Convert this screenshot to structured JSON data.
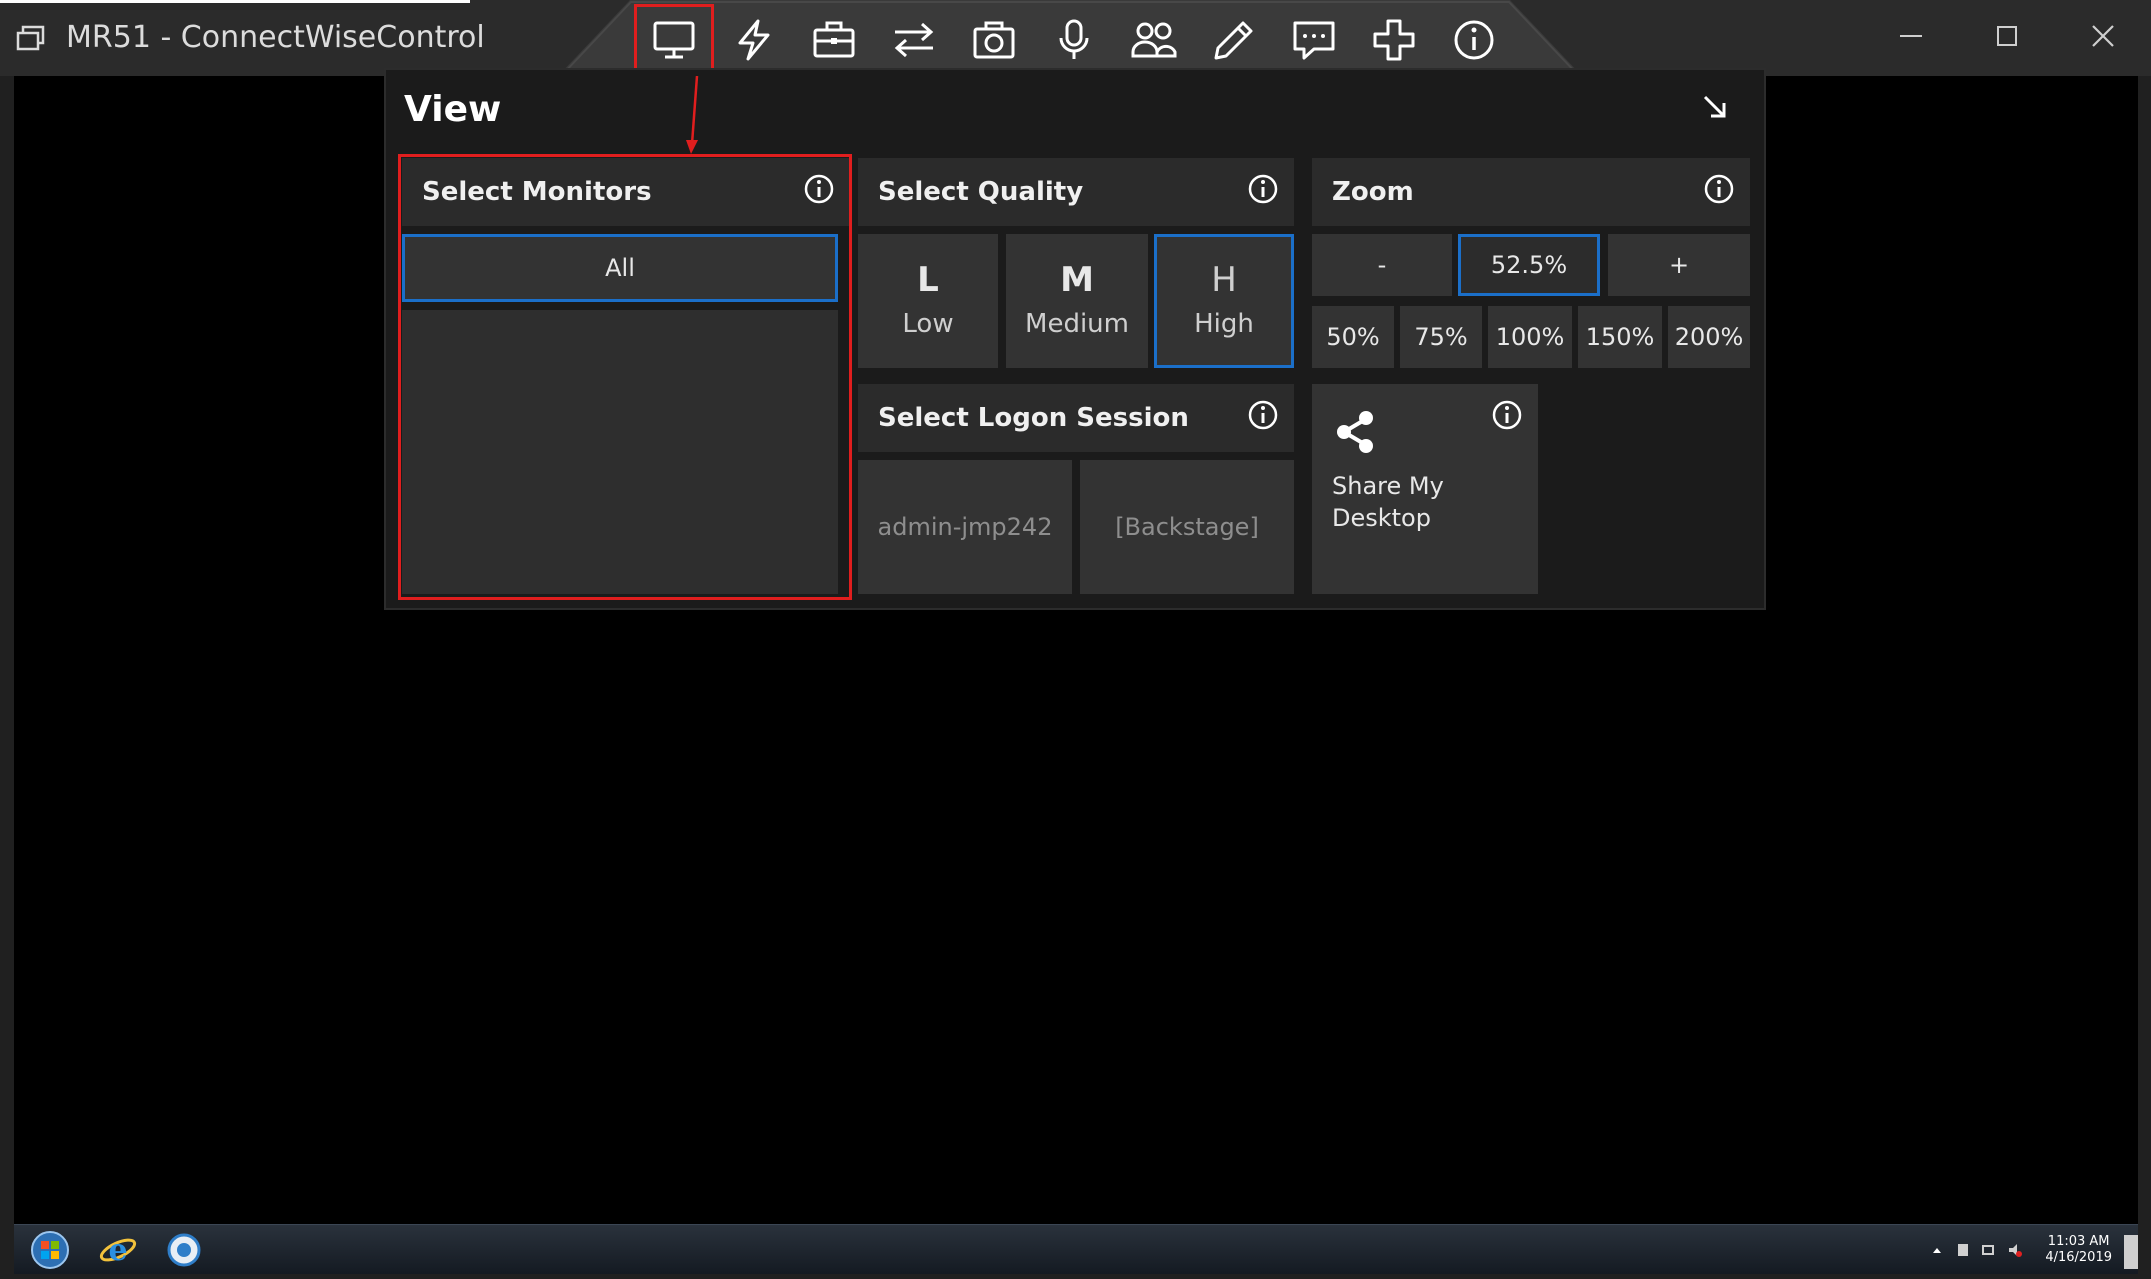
{
  "window": {
    "title": "MR51 - ConnectWiseControl"
  },
  "toolbar": {
    "items": [
      {
        "name": "view",
        "icon": "monitor-icon",
        "selected": true
      },
      {
        "name": "actions",
        "icon": "lightning-icon"
      },
      {
        "name": "toolbox",
        "icon": "briefcase-icon"
      },
      {
        "name": "transfer",
        "icon": "transfer-arrows-icon"
      },
      {
        "name": "screenshot",
        "icon": "camera-icon"
      },
      {
        "name": "audio",
        "icon": "microphone-icon"
      },
      {
        "name": "participants",
        "icon": "people-icon"
      },
      {
        "name": "annotate",
        "icon": "pencil-icon"
      },
      {
        "name": "messages",
        "icon": "chat-icon"
      },
      {
        "name": "extensions",
        "icon": "puzzle-icon"
      },
      {
        "name": "info",
        "icon": "info-circle-icon"
      }
    ]
  },
  "view_panel": {
    "title": "View",
    "monitors": {
      "header": "Select Monitors",
      "options": [
        {
          "label": "All",
          "selected": true
        }
      ]
    },
    "quality": {
      "header": "Select Quality",
      "options": [
        {
          "letter": "L",
          "label": "Low",
          "selected": false
        },
        {
          "letter": "M",
          "label": "Medium",
          "selected": false
        },
        {
          "letter": "H",
          "label": "High",
          "selected": true
        }
      ]
    },
    "zoom": {
      "header": "Zoom",
      "decrease": "-",
      "current": "52.5%",
      "increase": "+",
      "presets": [
        "50%",
        "75%",
        "100%",
        "150%",
        "200%"
      ]
    },
    "logon_session": {
      "header": "Select Logon Session",
      "options": [
        "admin-jmp242",
        "[Backstage]"
      ]
    },
    "share": {
      "line1": "Share My",
      "line2": "Desktop"
    }
  },
  "taskbar": {
    "apps": [
      "start-orb-icon",
      "internet-explorer-icon",
      "connectwise-icon"
    ],
    "clock_time": "11:03 AM",
    "clock_date": "4/16/2019"
  },
  "colors": {
    "highlight_red": "#e01e1e",
    "selection_blue": "#1b6fc9",
    "panel_bg": "#1b1b1b",
    "tile_bg": "#333333"
  }
}
